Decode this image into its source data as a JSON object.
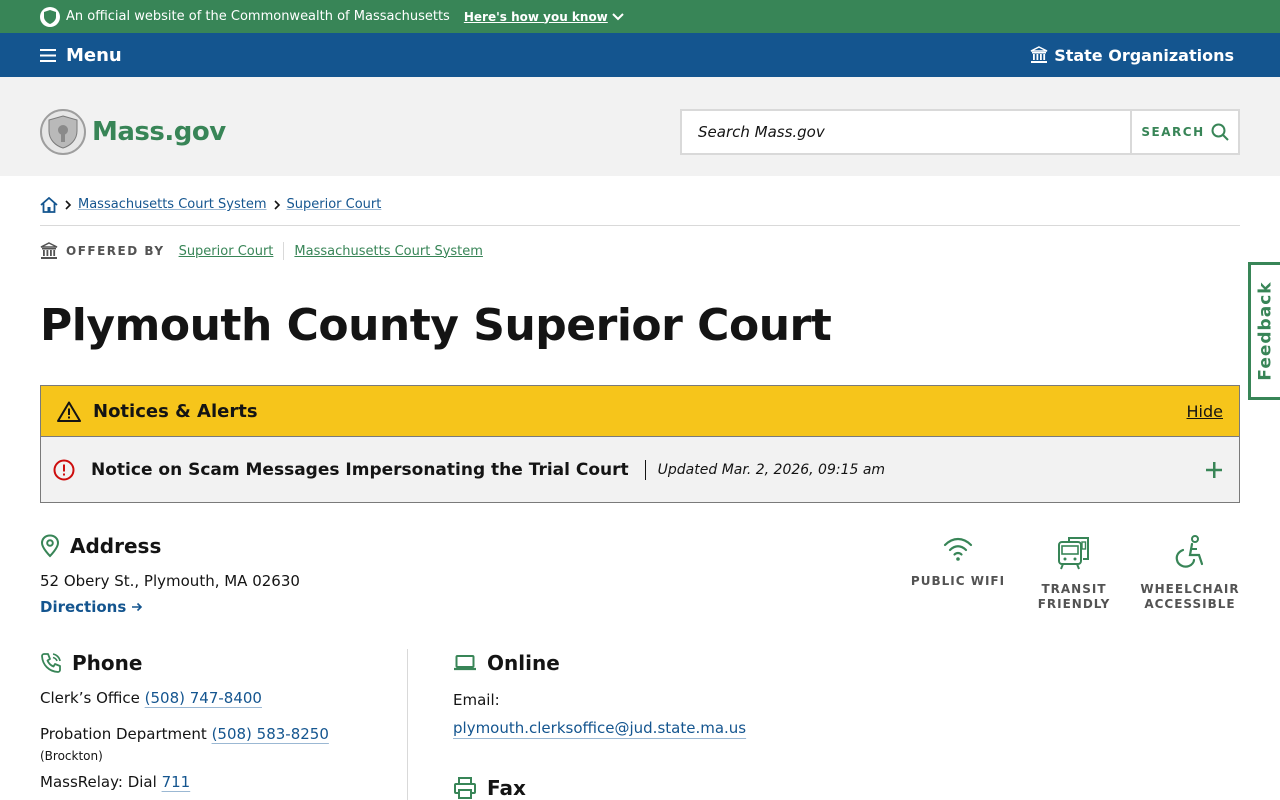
{
  "official_bar": {
    "text": "An official website of the Commonwealth of Massachusetts",
    "how_label": "Here's how you know"
  },
  "menu_bar": {
    "menu_label": "Menu",
    "state_orgs_label": "State Organizations"
  },
  "header": {
    "logo_text": "Mass.gov",
    "search_placeholder": "Search Mass.gov",
    "search_button": "SEARCH"
  },
  "breadcrumb": {
    "items": [
      "Massachusetts Court System",
      "Superior Court"
    ]
  },
  "offered_by": {
    "label": "OFFERED BY",
    "links": [
      "Superior Court",
      "Massachusetts Court System"
    ]
  },
  "page_title": "Plymouth County Superior Court",
  "alerts": {
    "title": "Notices & Alerts",
    "hide_label": "Hide",
    "items": [
      {
        "title": "Notice on Scam Messages Impersonating the Trial Court",
        "updated": "Updated Mar. 2, 2026, 09:15 am"
      }
    ]
  },
  "address": {
    "heading": "Address",
    "line": "52 Obery St., Plymouth, MA 02630",
    "directions_label": "Directions"
  },
  "amenities": [
    {
      "icon": "wifi-icon",
      "label_1": "PUBLIC WIFI",
      "label_2": ""
    },
    {
      "icon": "transit-icon",
      "label_1": "TRANSIT",
      "label_2": "FRIENDLY"
    },
    {
      "icon": "wheelchair-icon",
      "label_1": "WHEELCHAIR",
      "label_2": "ACCESSIBLE"
    }
  ],
  "phone": {
    "heading": "Phone",
    "rows": [
      {
        "label": "Clerk’s Office",
        "number": "(508) 747-8400"
      },
      {
        "label": "Probation Department",
        "number": "(508) 583-8250",
        "note": "(Brockton)"
      },
      {
        "label": "MassRelay: Dial",
        "number": "711"
      }
    ]
  },
  "online": {
    "heading": "Online",
    "email_label": "Email:",
    "email": "plymouth.clerksoffice@jud.state.ma.us"
  },
  "fax": {
    "heading": "Fax"
  },
  "feedback_label": "Feedback",
  "colors": {
    "green": "#388557",
    "blue": "#14558f",
    "yellow": "#f6c51b",
    "red": "#cd0d0d"
  }
}
